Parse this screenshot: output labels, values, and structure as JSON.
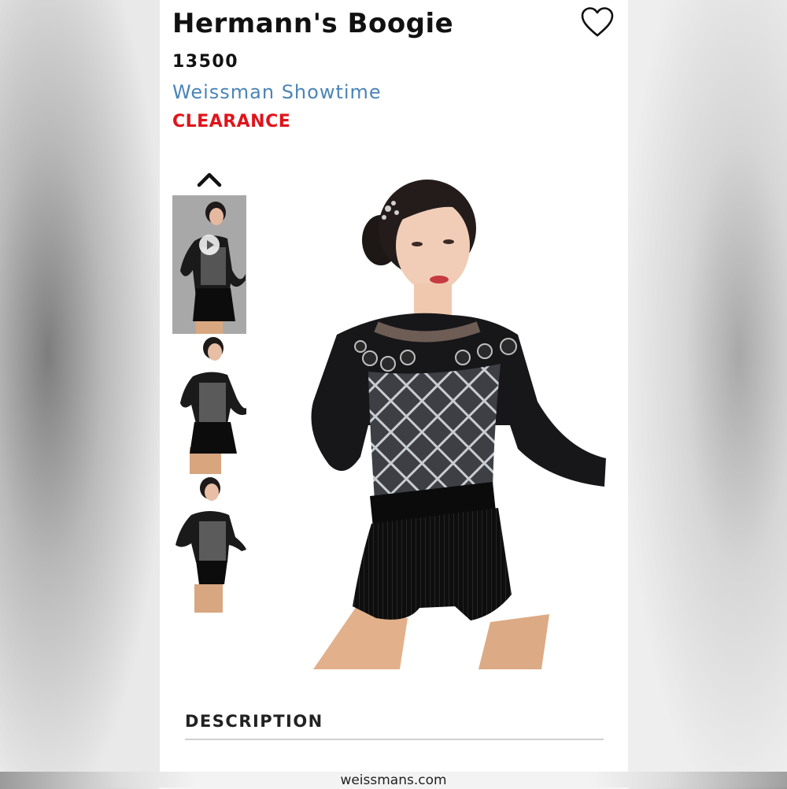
{
  "product": {
    "title": "Hermann's Boogie",
    "sku": "13500",
    "brand": "Weissman Showtime",
    "badge": "CLEARANCE",
    "wishlist_icon": "heart-outline-icon"
  },
  "gallery": {
    "scroll_up_icon": "chevron-up-icon",
    "thumbnails": [
      {
        "kind": "video",
        "icon": "play-icon"
      },
      {
        "kind": "image"
      },
      {
        "kind": "image"
      }
    ]
  },
  "description": {
    "heading": "DESCRIPTION"
  },
  "footer": {
    "site": "weissmans.com"
  },
  "colors": {
    "brand_link": "#4b84b8",
    "clearance": "#e0141b"
  }
}
